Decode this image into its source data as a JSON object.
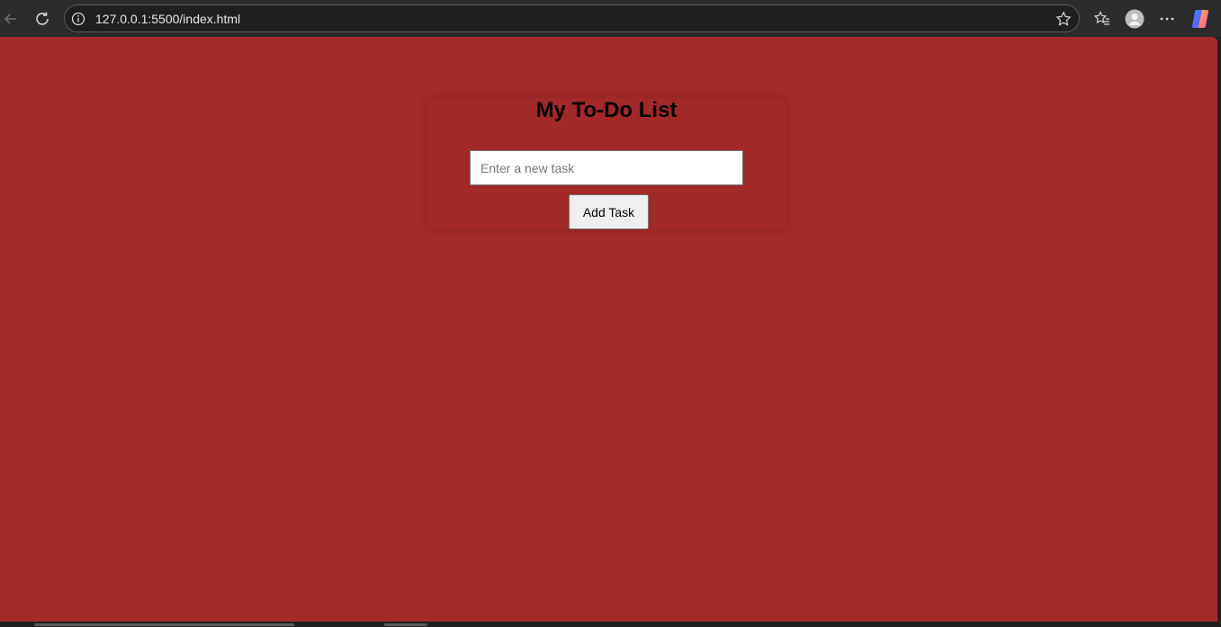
{
  "browser": {
    "url": "127.0.0.1:5500/index.html",
    "icons": [
      "back-arrow-icon",
      "refresh-icon",
      "site-info-icon",
      "favorite-star-icon",
      "favorites-icon",
      "profile-avatar-icon",
      "more-options-icon",
      "copilot-icon"
    ]
  },
  "page": {
    "background_color": "#a52a2a",
    "title": "My To-Do List",
    "task_input": {
      "value": "",
      "placeholder": "Enter a new task"
    },
    "add_button_label": "Add Task"
  }
}
